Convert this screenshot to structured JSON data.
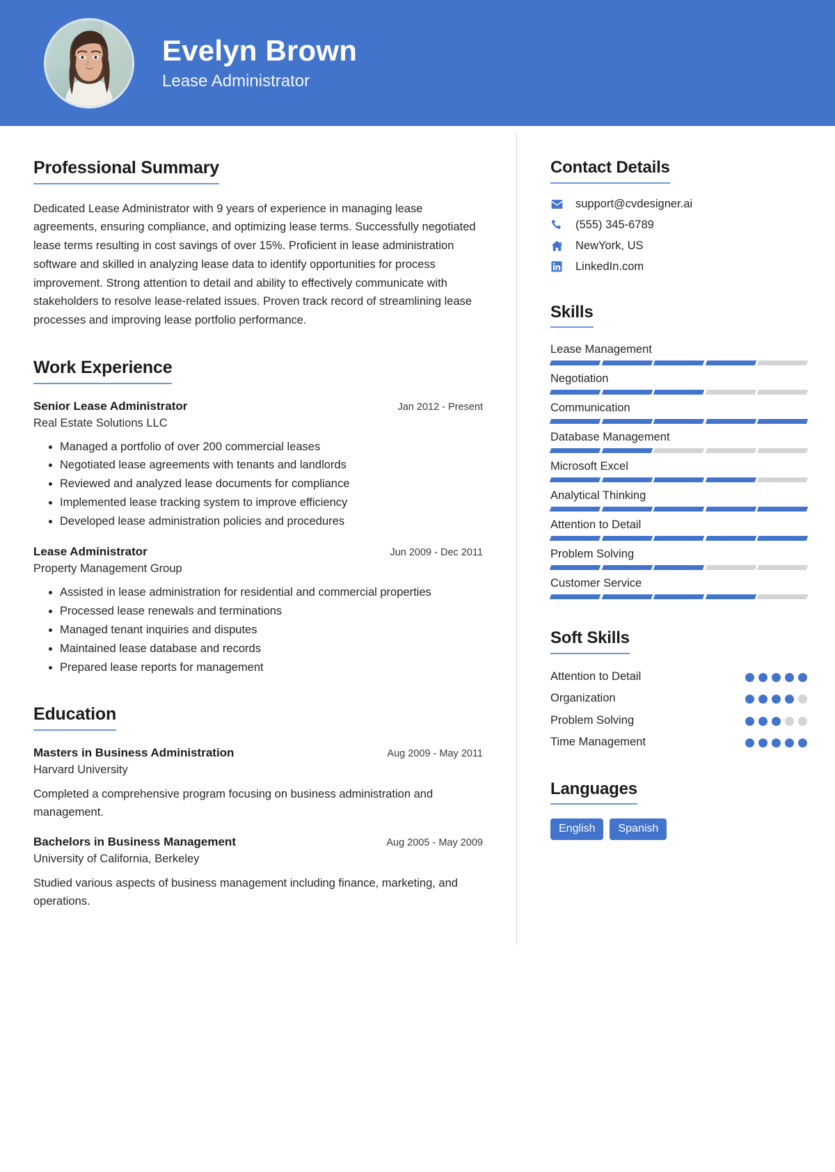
{
  "theme": {
    "accent": "#4274CC",
    "underline": "#6a97de",
    "bar_empty": "#d4d4d4",
    "text": "#262626"
  },
  "header": {
    "name": "Evelyn Brown",
    "role": "Lease Administrator",
    "avatar_alt": "profile-photo"
  },
  "summary": {
    "title": "Professional Summary",
    "text": "Dedicated Lease Administrator with 9 years of experience in managing lease agreements, ensuring compliance, and optimizing lease terms. Successfully negotiated lease terms resulting in cost savings of over 15%. Proficient in lease administration software and skilled in analyzing lease data to identify opportunities for process improvement. Strong attention to detail and ability to effectively communicate with stakeholders to resolve lease-related issues. Proven track record of streamlining lease processes and improving lease portfolio performance."
  },
  "work": {
    "title": "Work Experience",
    "entries": [
      {
        "position": "Senior Lease Administrator",
        "date": "Jan 2012 - Present",
        "company": "Real Estate Solutions LLC",
        "bullets": [
          "Managed a portfolio of over 200 commercial leases",
          "Negotiated lease agreements with tenants and landlords",
          "Reviewed and analyzed lease documents for compliance",
          "Implemented lease tracking system to improve efficiency",
          "Developed lease administration policies and procedures"
        ]
      },
      {
        "position": "Lease Administrator",
        "date": "Jun 2009 - Dec 2011",
        "company": "Property Management Group",
        "bullets": [
          "Assisted in lease administration for residential and commercial properties",
          "Processed lease renewals and terminations",
          "Managed tenant inquiries and disputes",
          "Maintained lease database and records",
          "Prepared lease reports for management"
        ]
      }
    ]
  },
  "education": {
    "title": "Education",
    "entries": [
      {
        "degree": "Masters in Business Administration",
        "date": "Aug 2009 - May 2011",
        "school": "Harvard University",
        "description": "Completed a comprehensive program focusing on business administration and management."
      },
      {
        "degree": "Bachelors in Business Management",
        "date": "Aug 2005 - May 2009",
        "school": "University of California, Berkeley",
        "description": "Studied various aspects of business management including finance, marketing, and operations."
      }
    ]
  },
  "contact": {
    "title": "Contact Details",
    "items": [
      {
        "icon": "envelope-icon",
        "value": "support@cvdesigner.ai"
      },
      {
        "icon": "phone-icon",
        "value": "(555) 345-6789"
      },
      {
        "icon": "home-icon",
        "value": "NewYork, US"
      },
      {
        "icon": "linkedin-icon",
        "value": "LinkedIn.com"
      }
    ]
  },
  "skills": {
    "title": "Skills",
    "max": 5,
    "items": [
      {
        "name": "Lease Management",
        "level": 4
      },
      {
        "name": "Negotiation",
        "level": 3
      },
      {
        "name": "Communication",
        "level": 5
      },
      {
        "name": "Database Management",
        "level": 2
      },
      {
        "name": "Microsoft Excel",
        "level": 4
      },
      {
        "name": "Analytical Thinking",
        "level": 5
      },
      {
        "name": "Attention to Detail",
        "level": 5
      },
      {
        "name": "Problem Solving",
        "level": 3
      },
      {
        "name": "Customer Service",
        "level": 4
      }
    ]
  },
  "soft_skills": {
    "title": "Soft Skills",
    "max": 5,
    "items": [
      {
        "name": "Attention to Detail",
        "level": 5
      },
      {
        "name": "Organization",
        "level": 4
      },
      {
        "name": "Problem Solving",
        "level": 3
      },
      {
        "name": "Time Management",
        "level": 5
      }
    ]
  },
  "languages": {
    "title": "Languages",
    "items": [
      "English",
      "Spanish"
    ]
  }
}
